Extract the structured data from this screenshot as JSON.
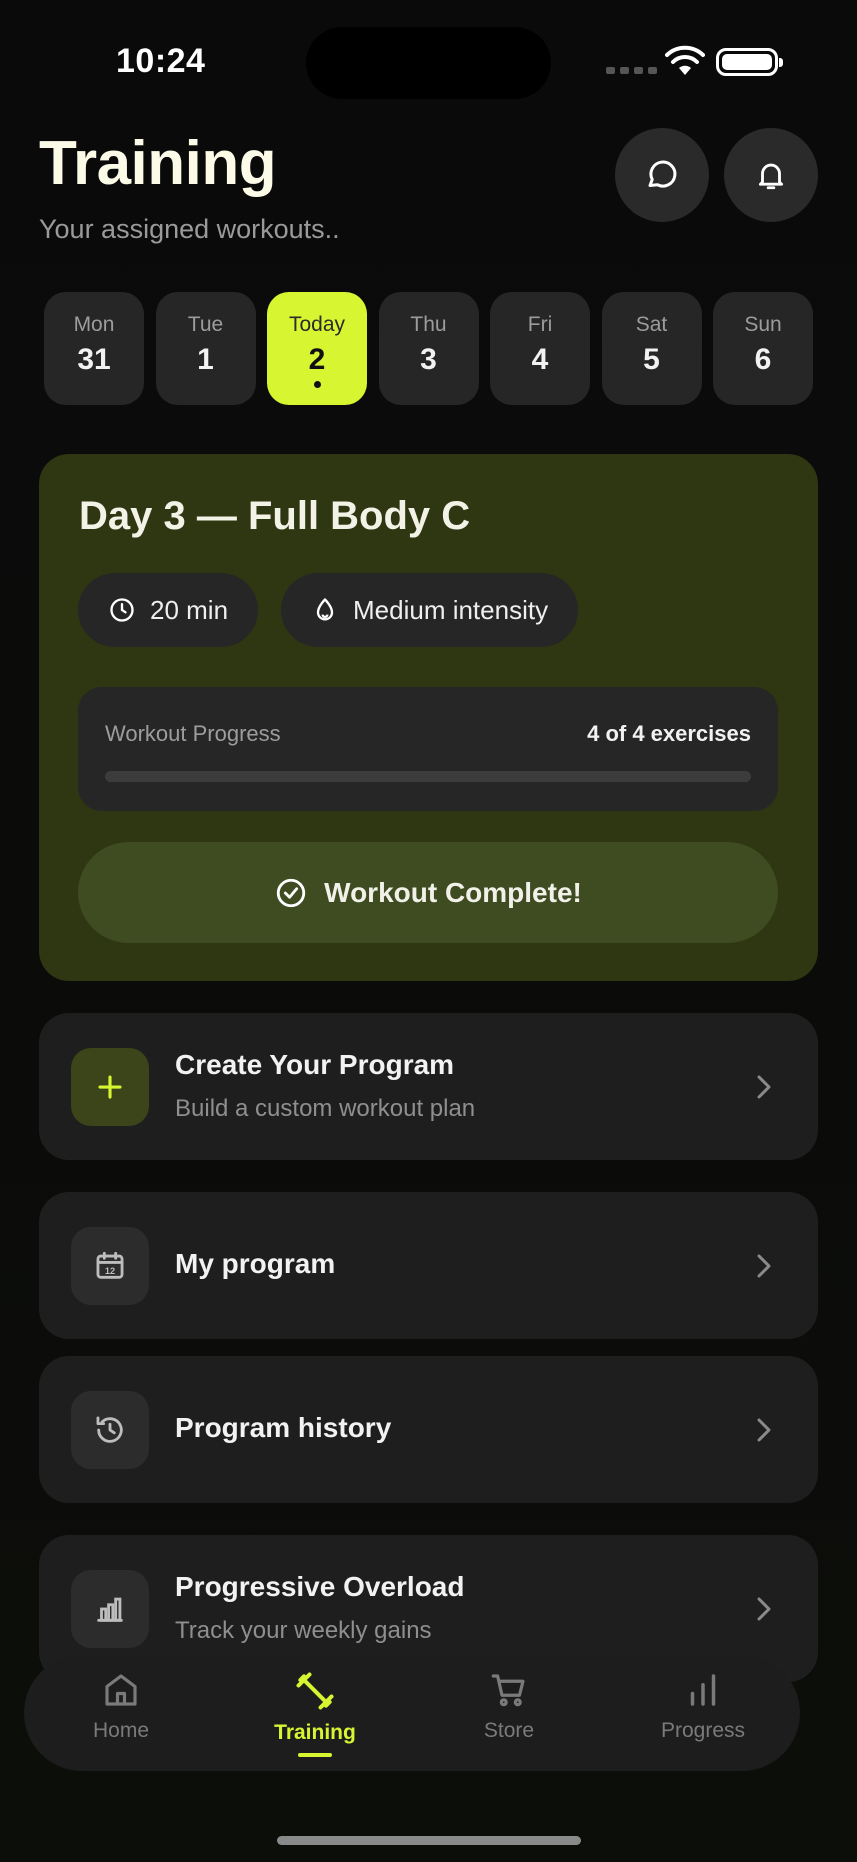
{
  "status_bar": {
    "time": "10:24"
  },
  "header": {
    "title": "Training",
    "subtitle": "Your assigned workouts.."
  },
  "days": [
    {
      "name": "Mon",
      "num": "31"
    },
    {
      "name": "Tue",
      "num": "1"
    },
    {
      "name": "Today",
      "num": "2"
    },
    {
      "name": "Thu",
      "num": "3"
    },
    {
      "name": "Fri",
      "num": "4"
    },
    {
      "name": "Sat",
      "num": "5"
    },
    {
      "name": "Sun",
      "num": "6"
    }
  ],
  "workout": {
    "title": "Day 3 — Full Body C",
    "duration": "20 min",
    "intensity": "Medium intensity",
    "progress_label": "Workout Progress",
    "progress_count": "4 of 4 exercises",
    "progress_fraction": 1.0,
    "complete_label": "Workout Complete!"
  },
  "cards": {
    "create": {
      "title": "Create Your Program",
      "subtitle": "Build a custom workout plan"
    },
    "my_program": {
      "title": "My program"
    },
    "history": {
      "title": "Program history"
    },
    "overload": {
      "title": "Progressive Overload",
      "subtitle": "Track your weekly gains"
    }
  },
  "nav": {
    "home": "Home",
    "training": "Training",
    "store": "Store",
    "progress": "Progress"
  },
  "colors": {
    "accent": "#d8f532",
    "card_olive": "#2e3612",
    "background": "#0b0b0b"
  },
  "icons": [
    "chat-icon",
    "bell-icon",
    "clock-icon",
    "flame-icon",
    "check-circle-icon",
    "plus-icon",
    "calendar-icon",
    "history-icon",
    "bar-chart-icon",
    "chevron-right-icon",
    "home-icon",
    "dumbbell-icon",
    "cart-icon",
    "progress-icon"
  ]
}
